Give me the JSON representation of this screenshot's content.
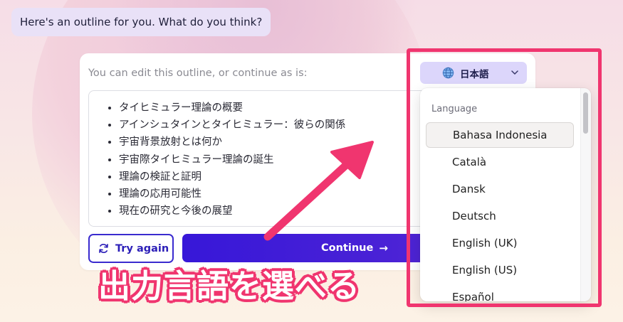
{
  "chat": {
    "assistant_message": "Here's an outline for you. What do you think?"
  },
  "outline_card": {
    "hint": "You can edit this outline, or continue as is:",
    "language_button": {
      "icon": "globe-icon",
      "label": "日本語",
      "chevron": "chevron-down-icon"
    },
    "items": [
      "タイヒミュラー理論の概要",
      "アインシュタインとタイヒミュラー：彼らの関係",
      "宇宙背景放射とは何か",
      "宇宙際タイヒミュラー理論の誕生",
      "理論の検証と証明",
      "理論の応用可能性",
      "現在の研究と今後の展望"
    ],
    "try_again_label": "Try again",
    "continue_label": "Continue",
    "continue_arrow": "→"
  },
  "language_dropdown": {
    "heading": "Language",
    "options": [
      "Bahasa Indonesia",
      "Català",
      "Dansk",
      "Deutsch",
      "English (UK)",
      "English (US)",
      "Español"
    ],
    "selected": "Bahasa Indonesia"
  },
  "annotation": {
    "caption": "出力言語を選べる",
    "color": "#f0356f"
  },
  "colors": {
    "accent": "#3a2bcf",
    "language_button_bg": "#dcd6fb",
    "bubble_bg": "#e9e1f7"
  }
}
